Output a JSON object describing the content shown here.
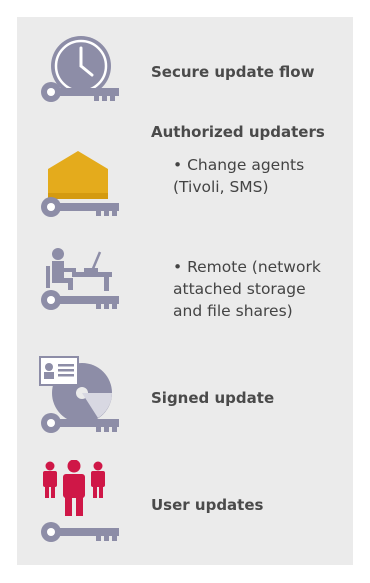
{
  "colors": {
    "panel": "#ebebeb",
    "icon_gray": "#8d8da7",
    "lock_gold": "#e4ab1c",
    "user_red": "#cf1747",
    "text": "#404040"
  },
  "items": [
    {
      "icon": "clock-key-icon",
      "title": "Secure update flow"
    },
    {
      "icon": "lock-key-icon",
      "title": "Authorized updaters",
      "bullet": "• Change agents\n(Tivoli, SMS)"
    },
    {
      "icon": "workstation-key-icon",
      "bullet": "• Remote (network\nattached storage\nand file shares)"
    },
    {
      "icon": "signed-cd-key-icon",
      "title": "Signed update"
    },
    {
      "icon": "users-key-icon",
      "title": "User updates"
    }
  ]
}
